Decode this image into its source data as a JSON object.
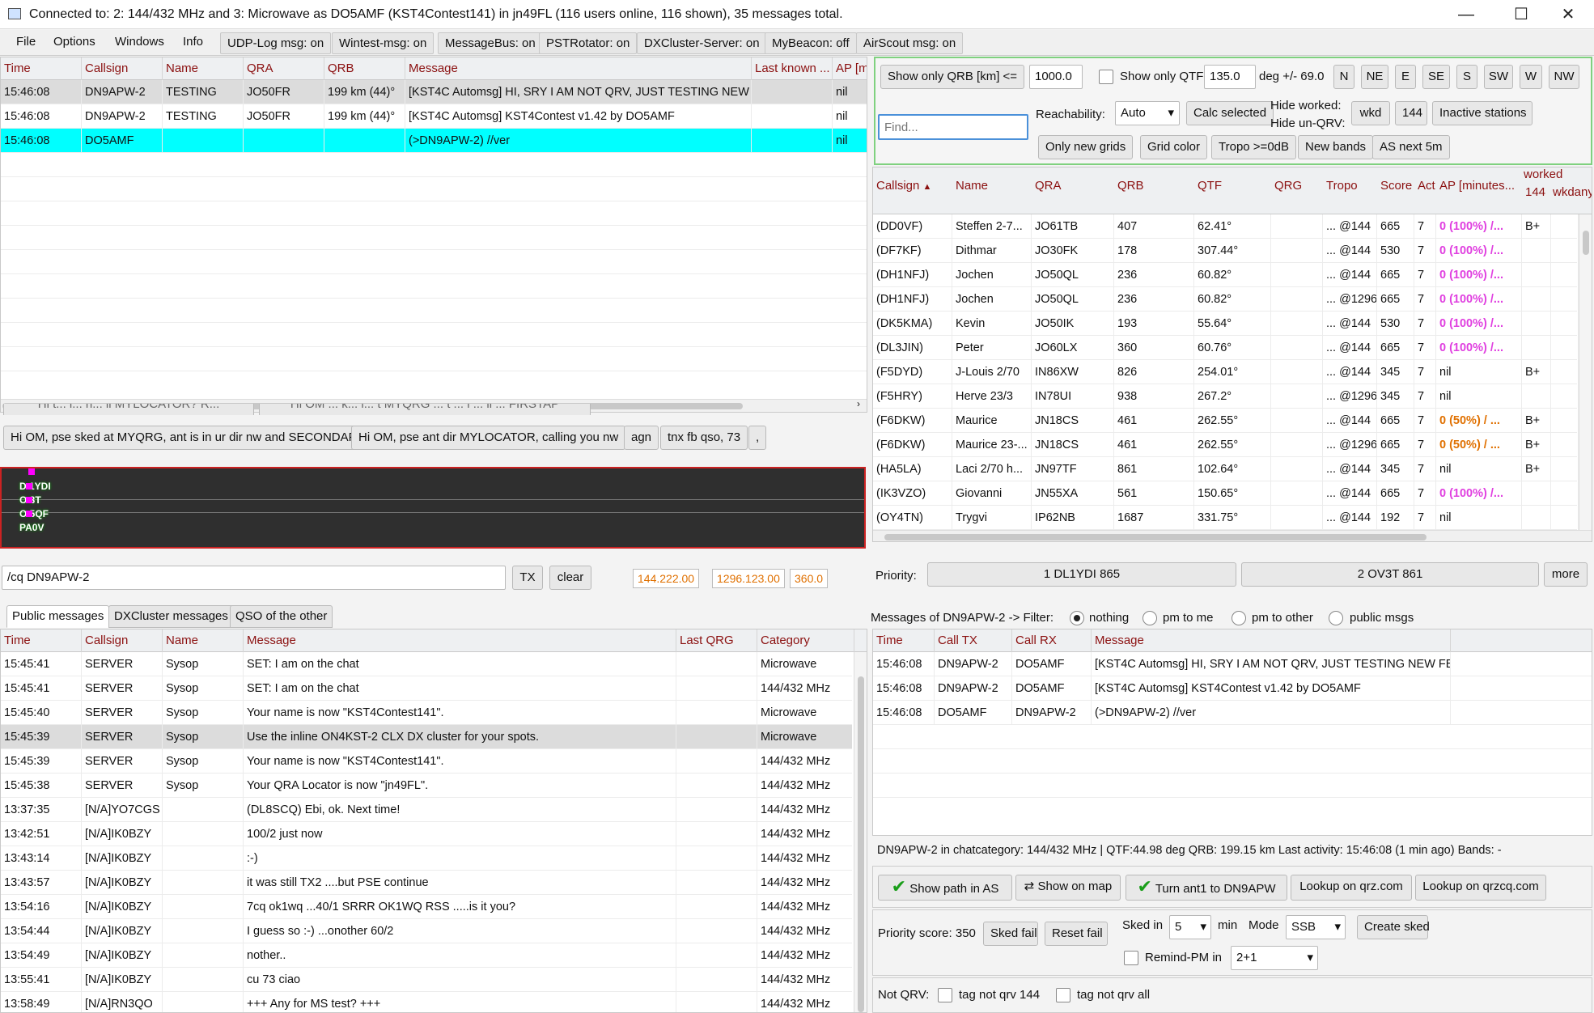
{
  "window": {
    "title": "Connected to: 2: 144/432 MHz and 3: Microwave  as DO5AMF (KST4Contest141) in jn49FL (116 users online, 116 shown), 35 messages total.",
    "minimize": "—",
    "maximize": "☐",
    "close": "✕"
  },
  "menu": [
    "File",
    "Options",
    "Windows",
    "Info"
  ],
  "toggles": [
    "UDP-Log msg: on",
    "Wintest-msg: on",
    "MessageBus: on",
    "PSTRotator: on",
    "DXCluster-Server: on",
    "MyBeacon: off",
    "AirScout msg: on"
  ],
  "top_msgs": {
    "headers": [
      "Time",
      "Callsign",
      "Name",
      "QRA",
      "QRB",
      "Message",
      "Last known ...",
      "AP [m"
    ],
    "rows": [
      [
        "15:46:08",
        "DN9APW-2",
        "TESTING",
        "JO50FR",
        "199 km (44)°",
        "[KST4C Automsg]  HI, SRY I AM NOT QRV, JUST TESTING NEW",
        "",
        "nil"
      ],
      [
        "15:46:08",
        "DN9APW-2",
        "TESTING",
        "JO50FR",
        "199 km (44)°",
        "[KST4C Automsg]  KST4Contest  v1.42 by DO5AMF",
        "",
        "nil"
      ],
      [
        "15:46:08",
        "DO5AMF",
        "",
        "",
        "",
        "(>DN9APW-2) //ver",
        "",
        "nil"
      ]
    ]
  },
  "snippets_hidden": [
    "Hi t... l... h... li MYLOCATOR? R...",
    "Hi OM ... k... l... t MYQRG ... t ... i ... li ... FIRSTAP"
  ],
  "snippets": [
    "Hi OM, pse sked at MYQRG, ant is in ur dir nw and SECONDAP",
    "Hi OM, pse ant dir MYLOCATOR, calling you nw",
    "agn",
    "tnx fb qso, 73",
    ","
  ],
  "scope_labels": [
    "D  1YDI",
    "O  3T",
    "O  5QF",
    "PA0V"
  ],
  "composer": {
    "value": "/cq DN9APW-2",
    "tx": "TX",
    "clear": "clear",
    "qrg1": "144.222.00",
    "qrg2": "1296.123.00",
    "qrg3": "360.0"
  },
  "tabs": [
    "Public messages",
    "DXCluster messages",
    "QSO of the other"
  ],
  "public": {
    "headers": [
      "Time",
      "Callsign",
      "Name",
      "Message",
      "Last QRG",
      "Category"
    ],
    "rows": [
      [
        "15:45:41",
        "SERVER",
        "Sysop",
        "SET: I am on the chat",
        "",
        "Microwave"
      ],
      [
        "15:45:41",
        "SERVER",
        "Sysop",
        "SET: I am on the chat",
        "",
        "144/432 MHz"
      ],
      [
        "15:45:40",
        "SERVER",
        "Sysop",
        "Your name is now \"KST4Contest141\".",
        "",
        "Microwave"
      ],
      [
        "15:45:39",
        "SERVER",
        "Sysop",
        "Use the inline ON4KST-2 CLX DX cluster for your spots.",
        "",
        "Microwave"
      ],
      [
        "15:45:39",
        "SERVER",
        "Sysop",
        "Your name is now \"KST4Contest141\".",
        "",
        "144/432 MHz"
      ],
      [
        "15:45:38",
        "SERVER",
        "Sysop",
        "Your QRA Locator is now \"jn49FL\".",
        "",
        "144/432 MHz"
      ],
      [
        "13:37:35",
        "[N/A]YO7CGS",
        "",
        "(DL8SCQ) Ebi, ok. Next time!",
        "",
        "144/432 MHz"
      ],
      [
        "13:42:51",
        "[N/A]IK0BZY",
        "",
        "100/2 just now",
        "",
        "144/432 MHz"
      ],
      [
        "13:43:14",
        "[N/A]IK0BZY",
        "",
        ":-)",
        "",
        "144/432 MHz"
      ],
      [
        "13:43:57",
        "[N/A]IK0BZY",
        "",
        "it was still TX2 ....but PSE continue",
        "",
        "144/432 MHz"
      ],
      [
        "13:54:16",
        "[N/A]IK0BZY",
        "",
        "7cq ok1wq  ...40/1 SRRR OK1WQ RSS .....is it you?",
        "",
        "144/432 MHz"
      ],
      [
        "13:54:44",
        "[N/A]IK0BZY",
        "",
        "I guess so :-) ...onother 60/2",
        "",
        "144/432 MHz"
      ],
      [
        "13:54:49",
        "[N/A]IK0BZY",
        "",
        "nother..",
        "",
        "144/432 MHz"
      ],
      [
        "13:55:41",
        "[N/A]IK0BZY",
        "",
        "cu 73 ciao",
        "",
        "144/432 MHz"
      ],
      [
        "13:58:49",
        "[N/A]RN3QO",
        "",
        "+++ Any for MS test? +++",
        "",
        "144/432 MHz"
      ]
    ]
  },
  "filters": {
    "qrb_btn": "Show only QRB [km] <=",
    "qrb_value": "1000.0",
    "qtf_label": "Show only QTF:",
    "qtf_value": "135.0",
    "qtf_tol": "deg +/- 69.0",
    "dirs": [
      "N",
      "NE",
      "E",
      "SE",
      "S",
      "SW",
      "W",
      "NW"
    ],
    "find_placeholder": "Find...",
    "reach_label": "Reachability:",
    "reach_value": "Auto",
    "calc_selected": "Calc selected",
    "hide_worked": "Hide worked:",
    "hide_unqrv": "Hide un-QRV:",
    "wkd": "wkd",
    "band144": "144",
    "inactive": "Inactive stations",
    "only_new": "Only new grids",
    "grid_color": "Grid color",
    "tropo": "Tropo >=0dB",
    "new_bands": "New bands",
    "as_next": "AS next 5m"
  },
  "users": {
    "headers": [
      "Callsign",
      "Name",
      "QRA",
      "QRB",
      "QTF",
      "QRG",
      "Tropo",
      "Score",
      "Act",
      "AP [minutes...",
      "worked"
    ],
    "sub_headers": [
      "144",
      "wkdany"
    ],
    "rows": [
      [
        "(DD0VF)",
        "Steffen 2-7...",
        "JO61TB",
        "407",
        "62.41°",
        "",
        "... @144",
        "665",
        "7",
        "0 (100%) /...",
        "B+",
        "pink"
      ],
      [
        "(DF7KF)",
        "Dithmar",
        "JO30FK",
        "178",
        "307.44°",
        "",
        "... @144",
        "530",
        "7",
        "0 (100%) /...",
        "",
        "pink"
      ],
      [
        "(DH1NFJ)",
        "Jochen",
        "JO50QL",
        "236",
        "60.82°",
        "",
        "... @144",
        "665",
        "7",
        "0 (100%) /...",
        "",
        "pink"
      ],
      [
        "(DH1NFJ)",
        "Jochen",
        "JO50QL",
        "236",
        "60.82°",
        "",
        "... @1296",
        "665",
        "7",
        "0 (100%) /...",
        "",
        "pink"
      ],
      [
        "(DK5KMA)",
        "Kevin",
        "JO50IK",
        "193",
        "55.64°",
        "",
        "... @144",
        "530",
        "7",
        "0 (100%) /...",
        "",
        "pink"
      ],
      [
        "(DL3JIN)",
        "Peter",
        "JO60LX",
        "360",
        "60.76°",
        "",
        "... @144",
        "665",
        "7",
        "0 (100%) /...",
        "",
        "pink"
      ],
      [
        "(F5DYD)",
        "J-Louis 2/70",
        "IN86XW",
        "826",
        "254.01°",
        "",
        "... @144",
        "345",
        "7",
        "nil",
        "B+",
        ""
      ],
      [
        "(F5HRY)",
        "Herve 23/3",
        "IN78UI",
        "938",
        "267.2°",
        "",
        "... @1296",
        "345",
        "7",
        "nil",
        "",
        ""
      ],
      [
        "(F6DKW)",
        "Maurice",
        "JN18CS",
        "461",
        "262.55°",
        "",
        "... @144",
        "665",
        "7",
        "0 (50%) / ...",
        "B+",
        "orange"
      ],
      [
        "(F6DKW)",
        "Maurice 23-...",
        "JN18CS",
        "461",
        "262.55°",
        "",
        "... @1296",
        "665",
        "7",
        "0 (50%) / ...",
        "B+",
        "orange"
      ],
      [
        "(HA5LA)",
        "Laci 2/70 h...",
        "JN97TF",
        "861",
        "102.64°",
        "",
        "... @144",
        "345",
        "7",
        "nil",
        "B+",
        ""
      ],
      [
        "(IK3VZO)",
        "Giovanni",
        "JN55XA",
        "561",
        "150.65°",
        "",
        "... @144",
        "665",
        "7",
        "0 (100%) /...",
        "",
        "pink"
      ],
      [
        "(OY4TN)",
        "Trygvi",
        "IP62NB",
        "1687",
        "331.75°",
        "",
        "... @144",
        "192",
        "7",
        "nil",
        "",
        ""
      ]
    ]
  },
  "priority": {
    "label": "Priority:",
    "p1": "1 DL1YDI 865",
    "p2": "2 OV3T 861",
    "more": "more"
  },
  "pm_filter": {
    "label": "Messages of DN9APW-2 -> Filter:",
    "options": [
      "nothing",
      "pm to me",
      "pm to other",
      "public msgs"
    ]
  },
  "pm": {
    "headers": [
      "Time",
      "Call TX",
      "Call RX",
      "Message"
    ],
    "rows": [
      [
        "15:46:08",
        "DN9APW-2",
        "DO5AMF",
        "[KST4C Automsg]  HI, SRY I AM NOT QRV, JUST TESTING NEW FE"
      ],
      [
        "15:46:08",
        "DN9APW-2",
        "DO5AMF",
        "[KST4C Automsg]  KST4Contest  v1.42 by DO5AMF"
      ],
      [
        "15:46:08",
        "DO5AMF",
        "DN9APW-2",
        "(>DN9APW-2) //ver"
      ]
    ]
  },
  "detail": {
    "info": "DN9APW-2 in chatcategory: 144/432 MHz  |  QTF:44.98 deg  QRB: 199.15 km  Last activity: 15:46:08  (1 min ago)  Bands: -",
    "show_path": "Show path in AS",
    "show_map": "Show on map",
    "turn_ant": "Turn ant1 to DN9APW",
    "qrz": "Lookup on qrz.com",
    "qrzcq": "Lookup on qrzcq.com",
    "prio_score": "Priority score: 350",
    "sked_fail": "Sked fail",
    "reset_fail": "Reset fail",
    "sked_in": "Sked in",
    "sked_value": "5",
    "min": "min",
    "mode_label": "Mode",
    "mode_value": "SSB",
    "create_sked": "Create sked",
    "remind_pm": "Remind-PM in",
    "remind_value": "2+1",
    "not_qrv": "Not QRV:",
    "tag144": "tag not qrv 144",
    "tagall": "tag not qrv all"
  }
}
